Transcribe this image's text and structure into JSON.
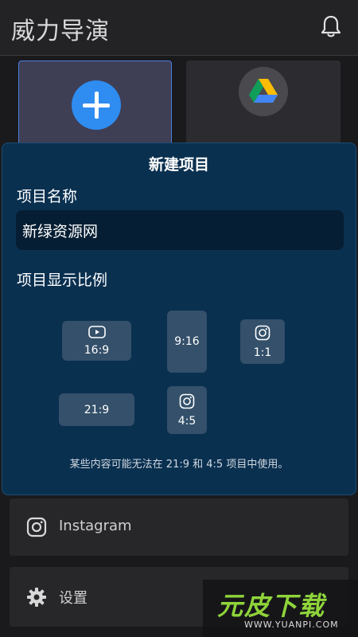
{
  "header": {
    "title": "威力导演",
    "icon": "bell-icon"
  },
  "tiles": {
    "new_project_icon": "plus-icon",
    "drive_icon": "google-drive-icon",
    "accent_color": "#2f8cf0"
  },
  "dialog": {
    "title": "新建项目",
    "name_label": "项目名称",
    "name_value": "新绿资源网",
    "ratio_label": "项目显示比例",
    "ratios": [
      {
        "label": "16:9",
        "icon": "youtube-icon"
      },
      {
        "label": "9:16",
        "icon": ""
      },
      {
        "label": "1:1",
        "icon": "instagram-icon"
      },
      {
        "label": "21:9",
        "icon": ""
      },
      {
        "label": "4:5",
        "icon": "instagram-icon"
      }
    ],
    "footnote": "某些内容可能无法在 21:9 和 4:5 项目中使用。",
    "background_color": "#0a3050"
  },
  "list": {
    "instagram_label": "Instagram",
    "settings_label": "设置"
  },
  "watermark": {
    "brand": "元皮下载",
    "url": "WWW.YUANPI.COM"
  }
}
